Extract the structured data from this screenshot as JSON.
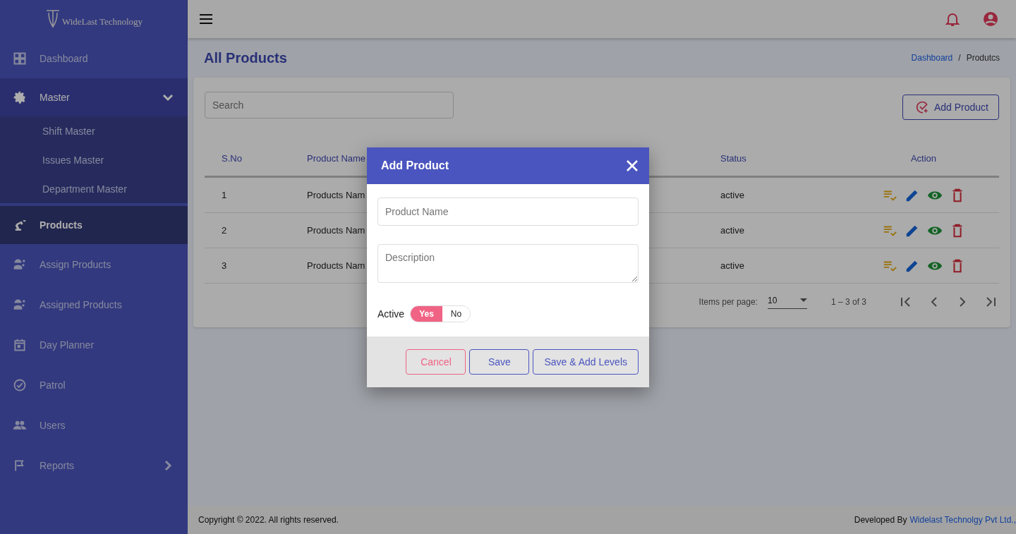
{
  "sidebar": {
    "logo_text": "WideLast Technology",
    "items": [
      {
        "label": "Dashboard",
        "selected": false
      },
      {
        "label": "Master",
        "selected": false,
        "expanded": true,
        "children": [
          {
            "label": "Shift Master"
          },
          {
            "label": "Issues Master"
          },
          {
            "label": "Department Master"
          }
        ]
      },
      {
        "label": "Products",
        "selected": true
      },
      {
        "label": "Assign Products",
        "selected": false
      },
      {
        "label": "Assigned Products",
        "selected": false
      },
      {
        "label": "Day Planner",
        "selected": false
      },
      {
        "label": "Patrol",
        "selected": false
      },
      {
        "label": "Users",
        "selected": false
      },
      {
        "label": "Reports",
        "selected": false,
        "expanded": false
      }
    ]
  },
  "page": {
    "title": "All Products",
    "breadcrumb_separator": "/",
    "breadcrumb": [
      {
        "label": "Dashboard",
        "kind": "link"
      },
      {
        "label": "Produtcs",
        "kind": "current"
      }
    ]
  },
  "toolbar": {
    "search": {
      "placeholder": "Search"
    },
    "add_button": "Add Product"
  },
  "table": {
    "columns": [
      "S.No",
      "Product Name",
      "Status",
      "Action"
    ],
    "rows": [
      {
        "sno": "1",
        "product_name": "Products Nam",
        "status": "active"
      },
      {
        "sno": "2",
        "product_name": "Products Nam",
        "status": "active"
      },
      {
        "sno": "3",
        "product_name": "Products Nam",
        "status": "active"
      }
    ]
  },
  "paginator": {
    "label": "Items per page:",
    "page_size": "10",
    "range": "1 – 3 of 3"
  },
  "footer": {
    "copyright": "Copyright © 2022. All rights reserved.",
    "developed_by": "Developed By",
    "developer_link": "Widelast Technolgy Pvt Ltd.,"
  },
  "dialog": {
    "title": "Add Product",
    "fields": [
      {
        "kind": "input",
        "placeholder": "Product Name"
      },
      {
        "kind": "textarea",
        "placeholder": "Description"
      }
    ],
    "active": {
      "label": "Active",
      "options": [
        {
          "label": "Yes",
          "selected": true
        },
        {
          "label": "No",
          "selected": false
        }
      ]
    },
    "buttons": [
      {
        "label": "Cancel",
        "kind": "cancel"
      },
      {
        "label": "Save",
        "kind": "primary"
      },
      {
        "label": "Save & Add Levels",
        "kind": "primary"
      }
    ]
  }
}
